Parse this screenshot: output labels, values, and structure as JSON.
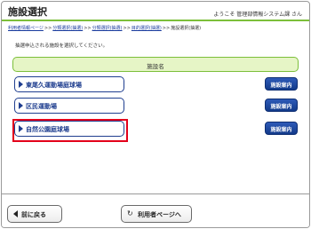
{
  "header": {
    "title": "施設選択",
    "welcome": "ようこそ 管理部情報システム課 さん"
  },
  "breadcrumb": {
    "items": [
      "利用者情報ページ",
      "分類選択(抽選)",
      "分類選択(抽選)",
      "目的選択(抽選)"
    ],
    "separator": ">>",
    "current": "施設選択(抽選)"
  },
  "instruction": "抽選申込される施設を選択してください。",
  "table": {
    "header": "施設名"
  },
  "facilities": [
    {
      "name": "東尾久運動場庭球場",
      "info_label": "施設案内"
    },
    {
      "name": "区民運動場",
      "info_label": "施設案内"
    },
    {
      "name": "自然公園庭球場",
      "info_label": "施設案内",
      "highlighted": true
    }
  ],
  "footer": {
    "back_label": "前に戻る",
    "user_page_label": "利用者ページへ"
  },
  "colors": {
    "accent_green": "#7cbf3a",
    "header_fill": "#e6f5c6",
    "button_blue": "#1f3e8f",
    "highlight_red": "#e3001b"
  }
}
